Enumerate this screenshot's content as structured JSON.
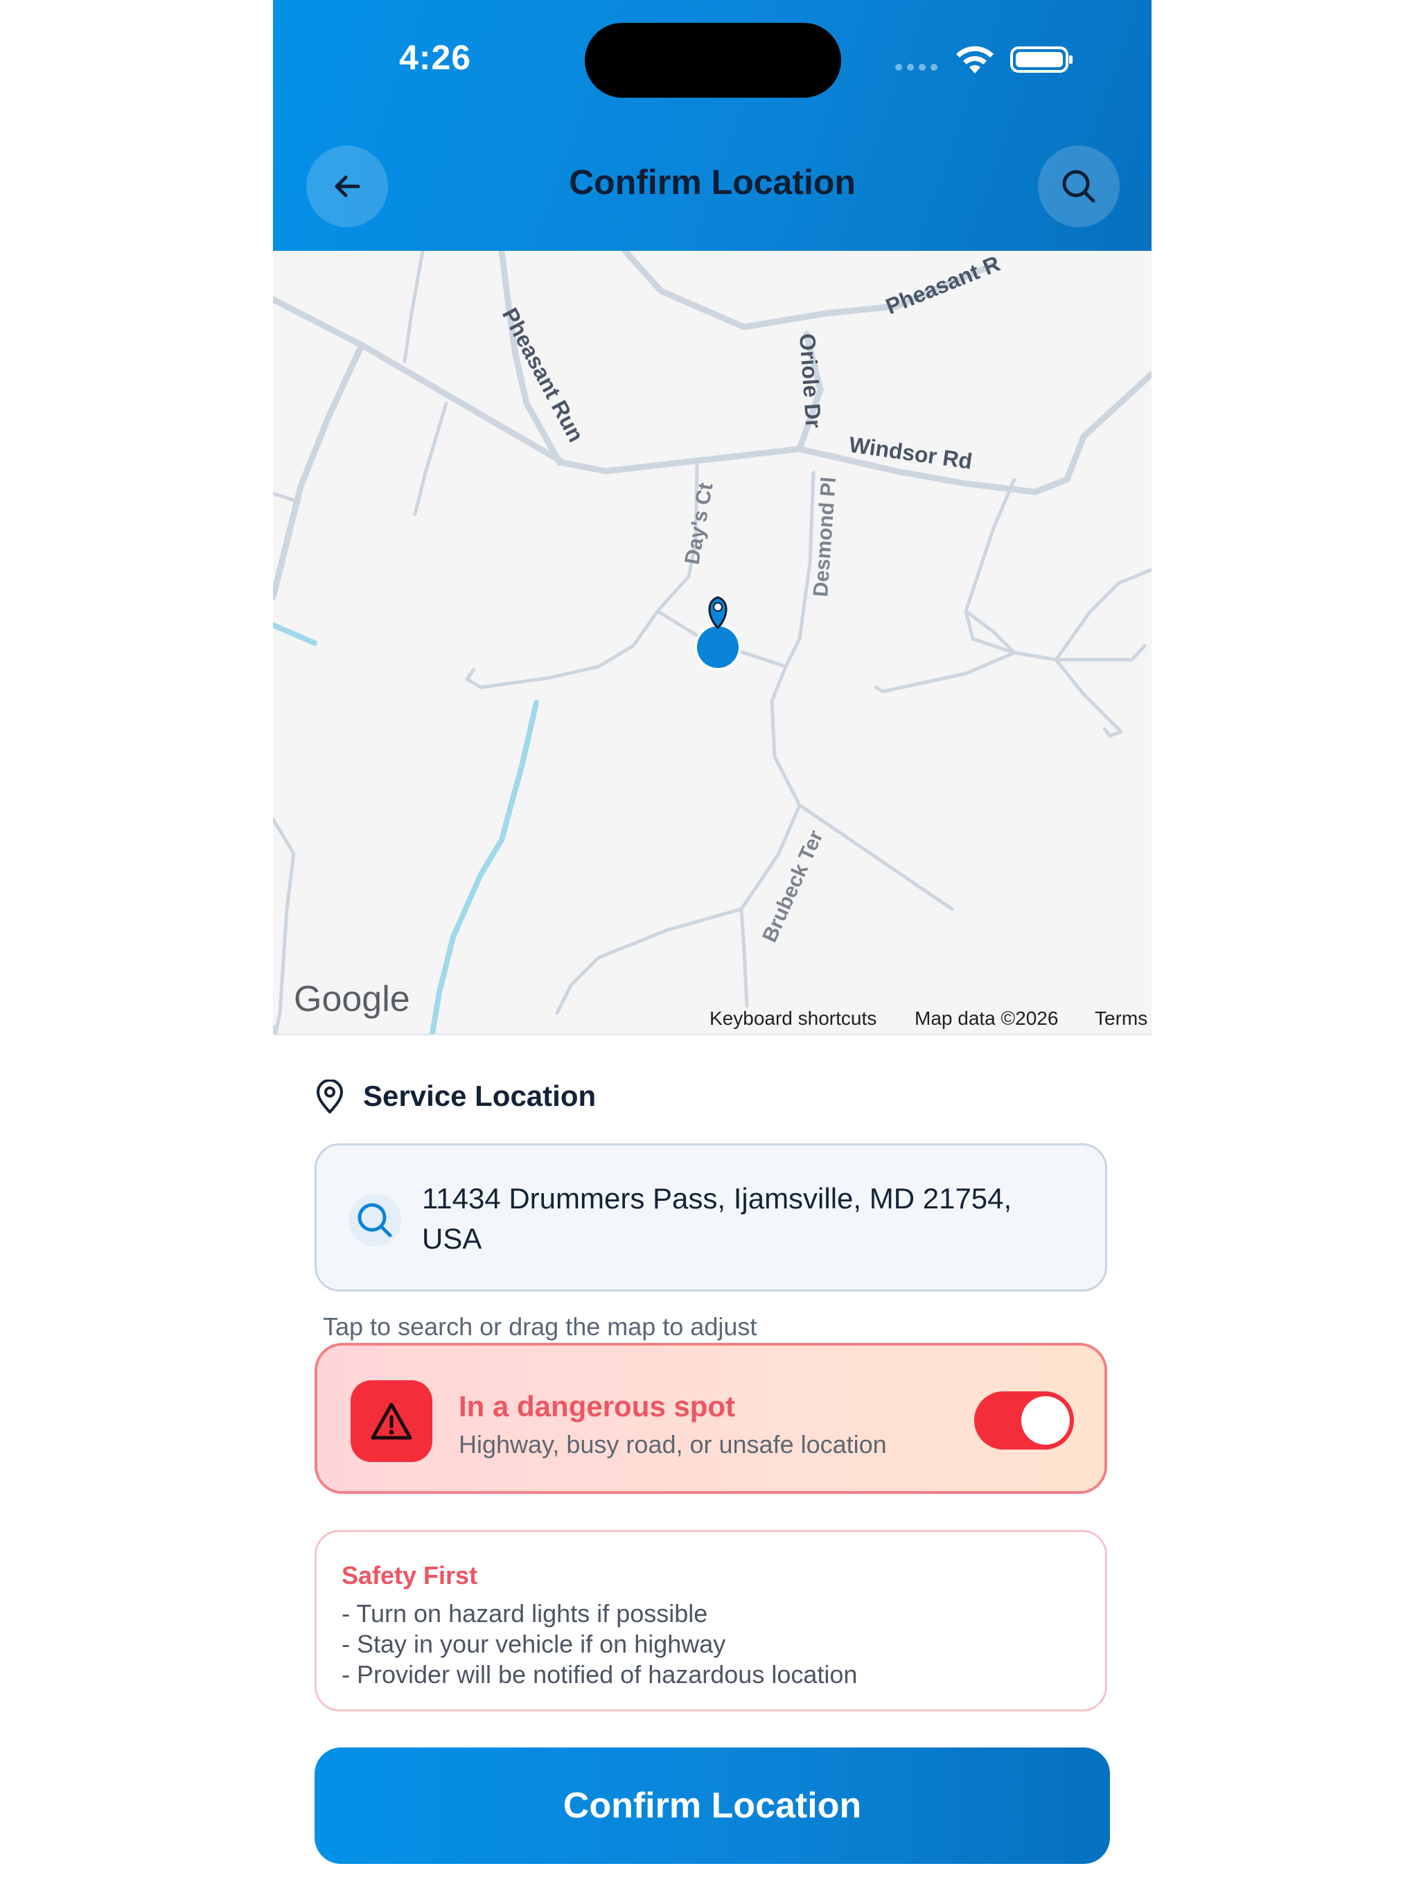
{
  "status_bar": {
    "time": "4:26"
  },
  "header": {
    "title": "Confirm Location",
    "back_icon": "arrow-left-icon",
    "search_icon": "search-icon"
  },
  "map": {
    "streets": {
      "pheasant_run": "Pheasant Run",
      "pheasant_top": "Pheasant R",
      "oriole": "Oriole Dr",
      "windsor": "Windsor Rd",
      "days_ct": "Day's Ct",
      "desmond": "Desmond Pl",
      "brubeck": "Brubeck Ter"
    },
    "logo": "Google",
    "footer": {
      "shortcuts": "Keyboard shortcuts",
      "map_data": "Map data ©2026",
      "terms": "Terms"
    }
  },
  "service_location": {
    "label": "Service Location",
    "address": "11434 Drummers Pass, Ijamsville, MD 21754, USA",
    "hint": "Tap to search or drag the map to adjust"
  },
  "danger": {
    "title": "In a dangerous spot",
    "subtitle": "Highway, busy road, or unsafe location",
    "enabled": true
  },
  "safety": {
    "title": "Safety First",
    "items": [
      "- Turn on hazard lights if possible",
      "- Stay in your vehicle if on highway",
      "- Provider will be notified of hazardous location"
    ]
  },
  "confirm_button": {
    "label": "Confirm Location"
  },
  "colors": {
    "primary": "#0a84d8",
    "danger": "#f42d3b",
    "danger_text": "#ee5562"
  }
}
